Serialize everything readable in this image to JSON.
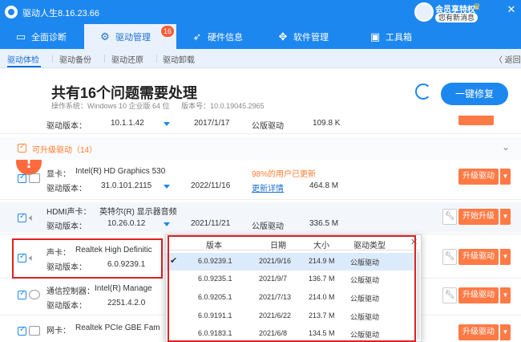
{
  "titlebar": {
    "app_title": "驱动人生8.16.23.66",
    "member_label": "会员享特权",
    "message_badge": "您有新消息"
  },
  "nav": {
    "items": [
      {
        "label": "全面诊断",
        "icon": "monitor-icon"
      },
      {
        "label": "驱动管理",
        "icon": "gear-icon",
        "badge": "16"
      },
      {
        "label": "硬件信息",
        "icon": "rocket-icon"
      },
      {
        "label": "软件管理",
        "icon": "apps-icon"
      },
      {
        "label": "工具箱",
        "icon": "toolbox-icon"
      }
    ]
  },
  "subtabs": {
    "items": [
      "驱动体检",
      "驱动备份",
      "驱动还原",
      "驱动卸载"
    ],
    "back": "返回"
  },
  "summary": {
    "headline": "共有16个问题需要处理",
    "os_label": "操作系统：Windows 10 企业版 64 位",
    "version_label": "版本号：10.0.19045.2965",
    "fix_button": "一键修复"
  },
  "rows": {
    "top": {
      "version_label": "驱动版本：",
      "version": "10.1.1.42",
      "date": "2017/1/17",
      "type": "公版驱动",
      "size": "109.8 K"
    },
    "group": {
      "label": "可升级驱动（14）"
    },
    "gpu": {
      "name_label": "显卡：",
      "name": "Intel(R) HD Graphics 530",
      "version_label": "驱动版本：",
      "version": "31.0.101.2115",
      "date": "2022/11/16",
      "hint": "98%的用户已更新",
      "detail_link": "更新详情",
      "size": "464.8 M",
      "button": "升级驱动"
    },
    "hdmi": {
      "name_label": "HDMI声卡：",
      "name": "英特尔(R) 显示器音频",
      "version_label": "驱动版本：",
      "version": "10.26.0.12",
      "date": "2021/11/21",
      "type": "公版驱动",
      "size": "336.5 M",
      "button": "开始升级"
    },
    "audio": {
      "name_label": "声卡：",
      "name": "Realtek High Definitic",
      "version_label": "驱动版本：",
      "version": "6.0.9239.1",
      "button": "升级驱动"
    },
    "comm": {
      "name_label": "通信控制器：",
      "name": "Intel(R) Manage",
      "version_label": "驱动版本：",
      "version": "2251.4.2.0",
      "button": "升级驱动"
    },
    "nic": {
      "name_label": "网卡：",
      "name": "Realtek PCIe GBE Fam",
      "button": "升级驱动"
    }
  },
  "popup": {
    "headers": [
      "版本",
      "日期",
      "大小",
      "驱动类型"
    ],
    "rows": [
      {
        "version": "6.0.9239.1",
        "date": "2021/9/16",
        "size": "214.9 M",
        "type": "公版驱动",
        "selected": true
      },
      {
        "version": "6.0.9235.1",
        "date": "2021/9/7",
        "size": "136.7 M",
        "type": "公版驱动"
      },
      {
        "version": "6.0.9205.1",
        "date": "2021/7/13",
        "size": "214.0 M",
        "type": "公版驱动"
      },
      {
        "version": "6.0.9191.1",
        "date": "2021/6/22",
        "size": "213.7 M",
        "type": "公版驱动"
      },
      {
        "version": "6.0.9183.1",
        "date": "2021/6/8",
        "size": "134.5 M",
        "type": "公版驱动"
      }
    ]
  }
}
